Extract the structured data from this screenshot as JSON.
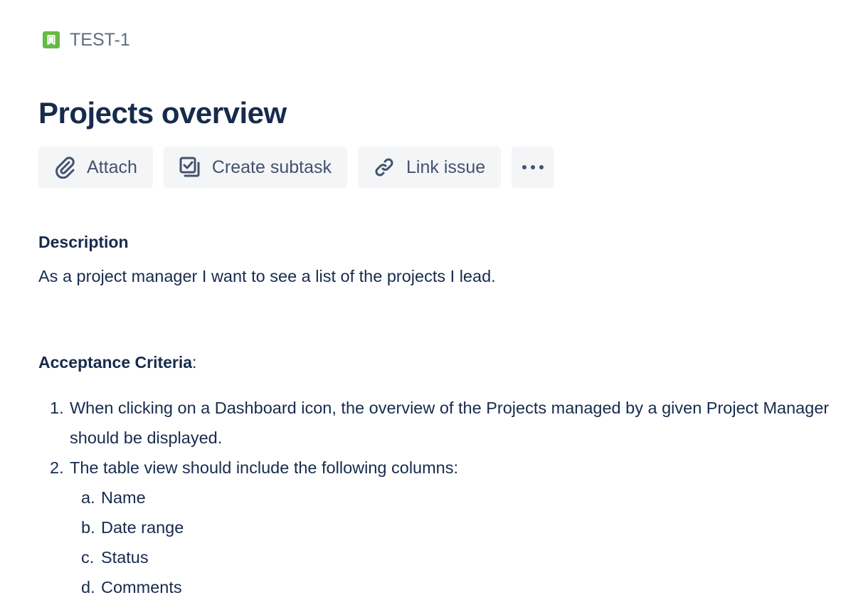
{
  "issue": {
    "key": "TEST-1",
    "type_icon": "story-bookmark-icon",
    "type_color": "#65ba43"
  },
  "title": "Projects overview",
  "toolbar": {
    "buttons": [
      {
        "label": "Attach",
        "icon": "paperclip-icon"
      },
      {
        "label": "Create subtask",
        "icon": "subtask-icon"
      },
      {
        "label": "Link issue",
        "icon": "link-icon"
      },
      {
        "label": "",
        "icon": "more-icon"
      }
    ]
  },
  "description": {
    "heading": "Description",
    "text": "As a project manager I want to see a list of the projects I lead.",
    "acceptance": {
      "heading": "Acceptance Criteria",
      "heading_suffix": ":",
      "items": [
        {
          "number": "1.",
          "text": "When clicking on a Dashboard icon, the overview of the Projects managed by a given Project Manager should be displayed."
        },
        {
          "number": "2.",
          "text": "The table view should include the following columns:",
          "subitems": [
            {
              "letter": "a.",
              "text": "Name"
            },
            {
              "letter": "b.",
              "text": "Date range"
            },
            {
              "letter": "c.",
              "text": "Status"
            },
            {
              "letter": "d.",
              "text": "Comments"
            }
          ]
        }
      ]
    }
  },
  "colors": {
    "text_primary": "#172b4d",
    "text_secondary": "#42526e",
    "button_bg": "#f4f5f7"
  }
}
